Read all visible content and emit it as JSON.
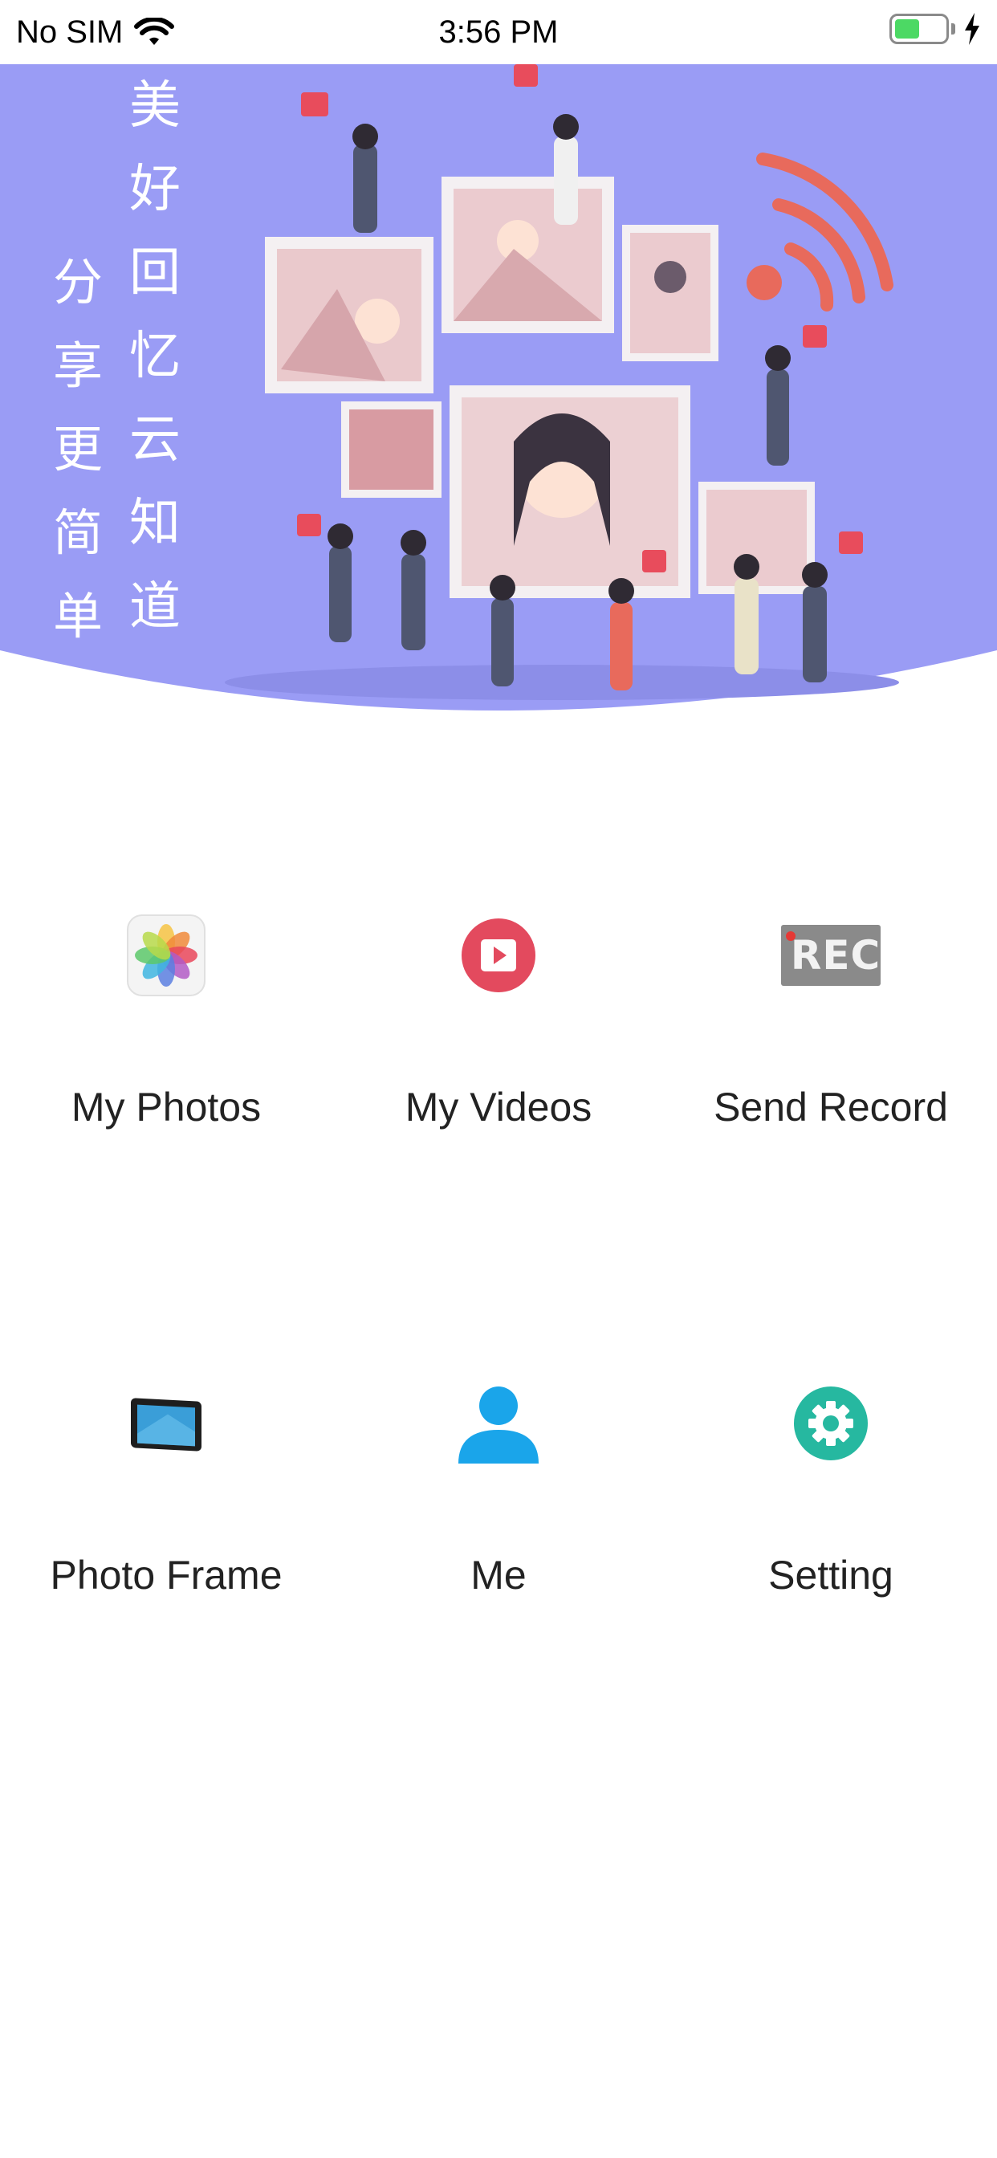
{
  "status_bar": {
    "carrier": "No SIM",
    "time": "3:56 PM",
    "battery_color": "#4cd964",
    "icons": [
      "wifi-icon",
      "battery-icon",
      "charging-bolt-icon"
    ]
  },
  "banner": {
    "calligraphy_col1": "美好回忆云知道",
    "calligraphy_col2": "分享更简单",
    "background_color": "#9a9cf5",
    "accent_wifi_color": "#e86a5c"
  },
  "menu": {
    "items": [
      {
        "label": "My Photos",
        "icon": "photos-flower-icon"
      },
      {
        "label": "My Videos",
        "icon": "play-video-icon"
      },
      {
        "label": "Send Record",
        "icon": "rec-icon"
      },
      {
        "label": "Photo Frame",
        "icon": "tablet-frame-icon"
      },
      {
        "label": "Me",
        "icon": "person-icon"
      },
      {
        "label": "Setting",
        "icon": "gear-icon"
      }
    ],
    "rec_text": "REC"
  }
}
